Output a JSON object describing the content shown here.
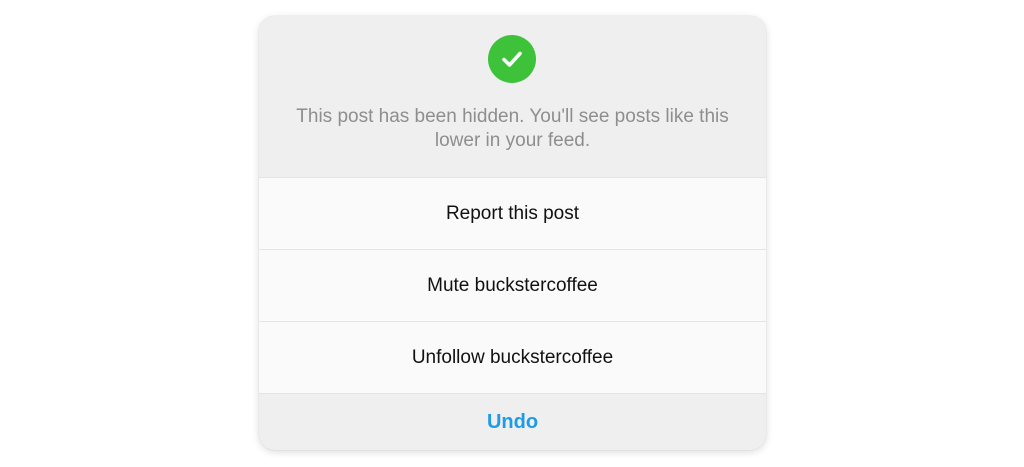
{
  "dialog": {
    "status_icon": "checkmark-circle-icon",
    "message": "This post has been hidden. You'll see posts like this lower in your feed.",
    "options": [
      {
        "label": "Report this post"
      },
      {
        "label": "Mute buckstercoffee"
      },
      {
        "label": "Unfollow buckstercoffee"
      }
    ],
    "undo_label": "Undo"
  },
  "colors": {
    "success": "#3dc23a",
    "link": "#1e9be8",
    "muted_text": "#8e8e8e",
    "primary_text": "#111111"
  }
}
